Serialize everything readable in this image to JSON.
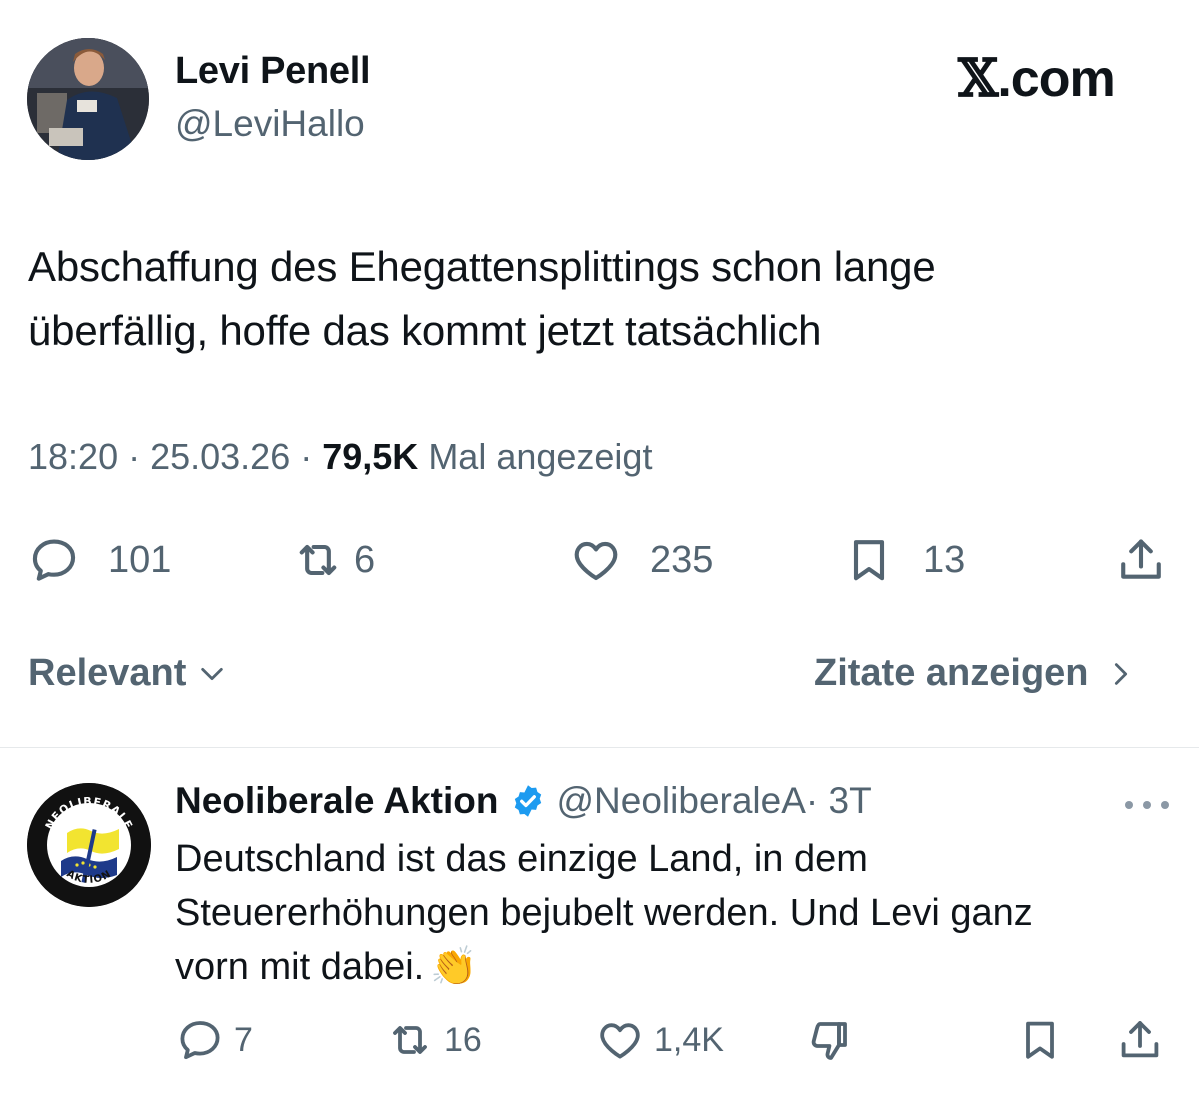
{
  "author": {
    "name": "Levi Penell",
    "handle": "@LeviHallo"
  },
  "brand": {
    "x": "𝕏",
    "suffix": ".com"
  },
  "tweet": {
    "text_line1": "Abschaffung des Ehegattensplittings schon lange",
    "text_line2": "überfällig, hoffe das kommt jetzt tatsächlich"
  },
  "meta": {
    "time": "18:20",
    "sep1": " · ",
    "date": "25.03.26",
    "sep2": " · ",
    "views": "79,5K",
    "views_label": " Mal angezeigt"
  },
  "actions": {
    "replies": "101",
    "reposts": "6",
    "likes": "235",
    "bookmarks": "13"
  },
  "sort": {
    "label": "Relevant"
  },
  "quotes": {
    "label": "Zitate anzeigen"
  },
  "reply": {
    "name": "Neoliberale Aktion",
    "handle": "@NeoliberaleA",
    "age": " · 3T",
    "avatar_top_text": "NEOLIBERALE",
    "avatar_bottom_text": "AKTION",
    "line1": "Deutschland ist das einzige Land, in dem",
    "line2": "Steuererhöhungen bejubelt werden. Und Levi ganz",
    "line3": "vorn mit dabei.",
    "emoji": "👏",
    "actions": {
      "replies": "7",
      "reposts": "16",
      "likes": "1,4K"
    }
  },
  "colors": {
    "text": "#0f1419",
    "secondary": "#536471",
    "verified": "#1d9bf0",
    "divider": "#e6e9eb"
  }
}
